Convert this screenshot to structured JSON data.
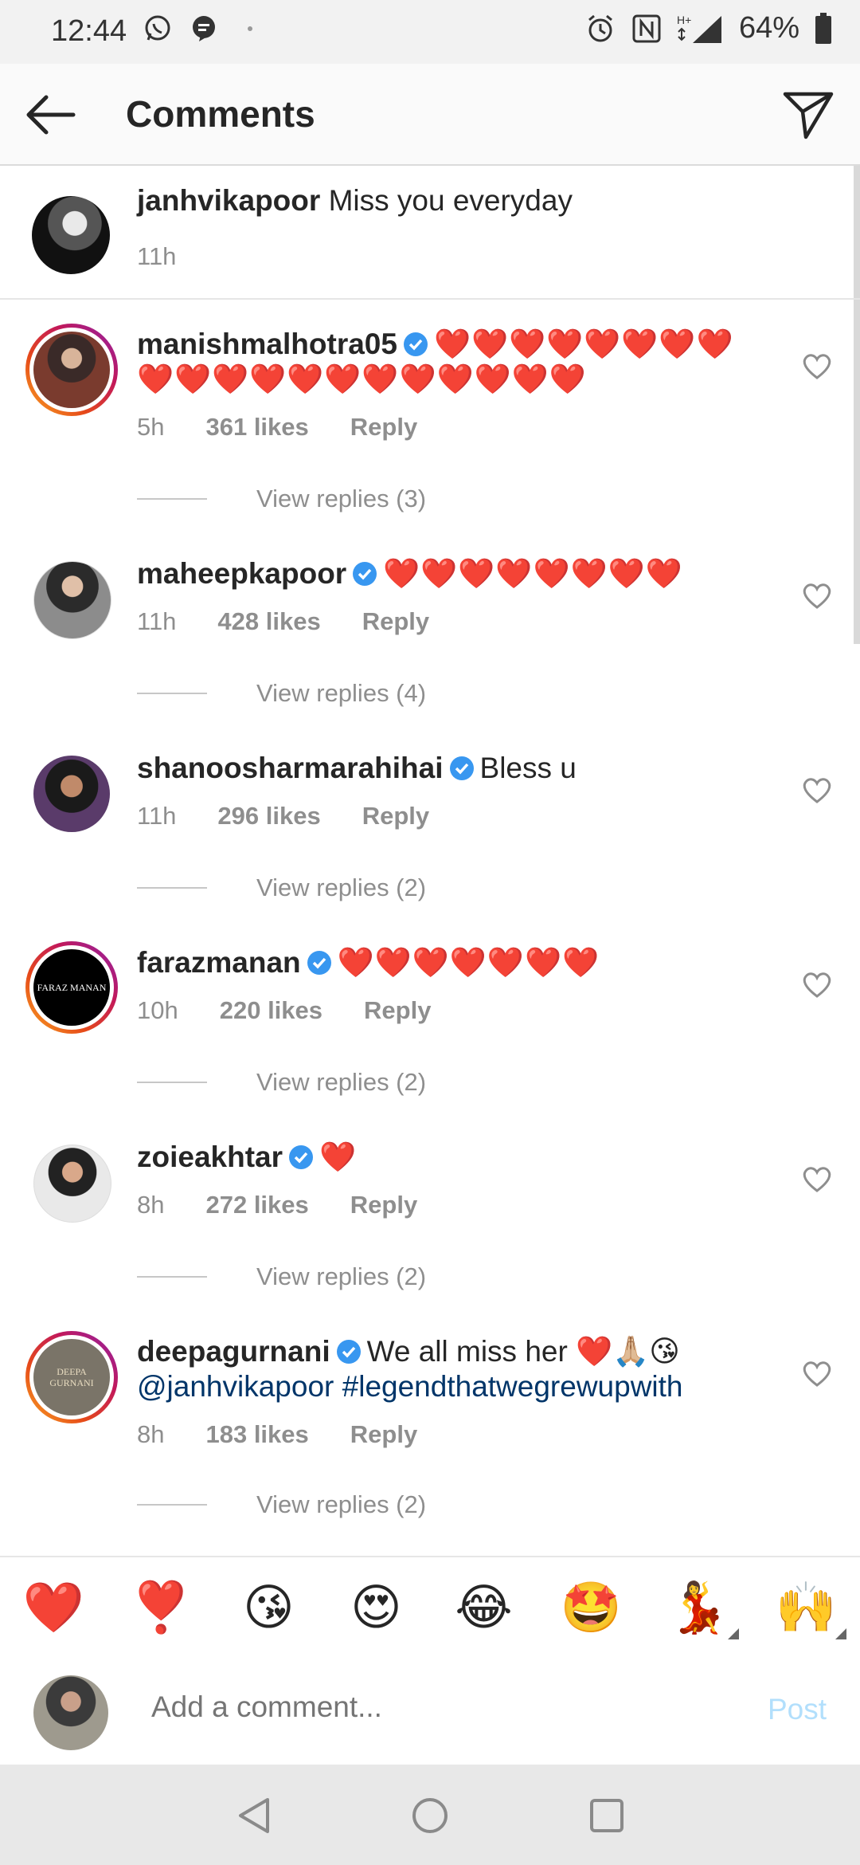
{
  "status_bar": {
    "time": "12:44",
    "battery": "64%",
    "network": "H+"
  },
  "header": {
    "title": "Comments"
  },
  "caption": {
    "username": "janhvikapoor",
    "text": "Miss you everyday",
    "time": "11h"
  },
  "comments": [
    {
      "username": "manishmalhotra05",
      "verified": true,
      "text_line1": "❤️❤️❤️❤️❤️❤️❤️❤️",
      "text_line2": "❤️❤️❤️❤️❤️❤️❤️❤️❤️❤️❤️❤️",
      "time": "5h",
      "likes": "361 likes",
      "reply": "Reply",
      "view_replies": "View replies (3)"
    },
    {
      "username": "maheepkapoor",
      "verified": true,
      "text_line1": "❤️❤️❤️❤️❤️❤️❤️❤️",
      "time": "11h",
      "likes": "428 likes",
      "reply": "Reply",
      "view_replies": "View replies (4)"
    },
    {
      "username": "shanoosharmarahihai",
      "verified": true,
      "text_line1": "Bless u",
      "time": "11h",
      "likes": "296 likes",
      "reply": "Reply",
      "view_replies": "View replies (2)"
    },
    {
      "username": "farazmanan",
      "verified": true,
      "avatar_text": "FARAZ MANAN",
      "text_line1": "❤️❤️❤️❤️❤️❤️❤️",
      "time": "10h",
      "likes": "220 likes",
      "reply": "Reply",
      "view_replies": "View replies (2)"
    },
    {
      "username": "zoieakhtar",
      "verified": true,
      "text_line1": "❤️",
      "time": "8h",
      "likes": "272 likes",
      "reply": "Reply",
      "view_replies": "View replies (2)"
    },
    {
      "username": "deepagurnani",
      "verified": true,
      "avatar_text": "DEEPA GURNANI",
      "text_line1": "We all miss her ❤️🙏🏼😘",
      "text_line2": "@janhvikapoor #legendthatwegrewupwith",
      "time": "8h",
      "likes": "183 likes",
      "reply": "Reply",
      "view_replies": "View replies (2)"
    }
  ],
  "quick_emojis": [
    "❤️",
    "❣️",
    "😘",
    "😍",
    "😂",
    "🤩",
    "💃",
    "🙌"
  ],
  "composer": {
    "placeholder": "Add a comment...",
    "post_label": "Post"
  },
  "colors": {
    "link": "#003569",
    "heart": "#e0141c",
    "verified": "#3897f0",
    "post_disabled": "#b2dffc"
  }
}
